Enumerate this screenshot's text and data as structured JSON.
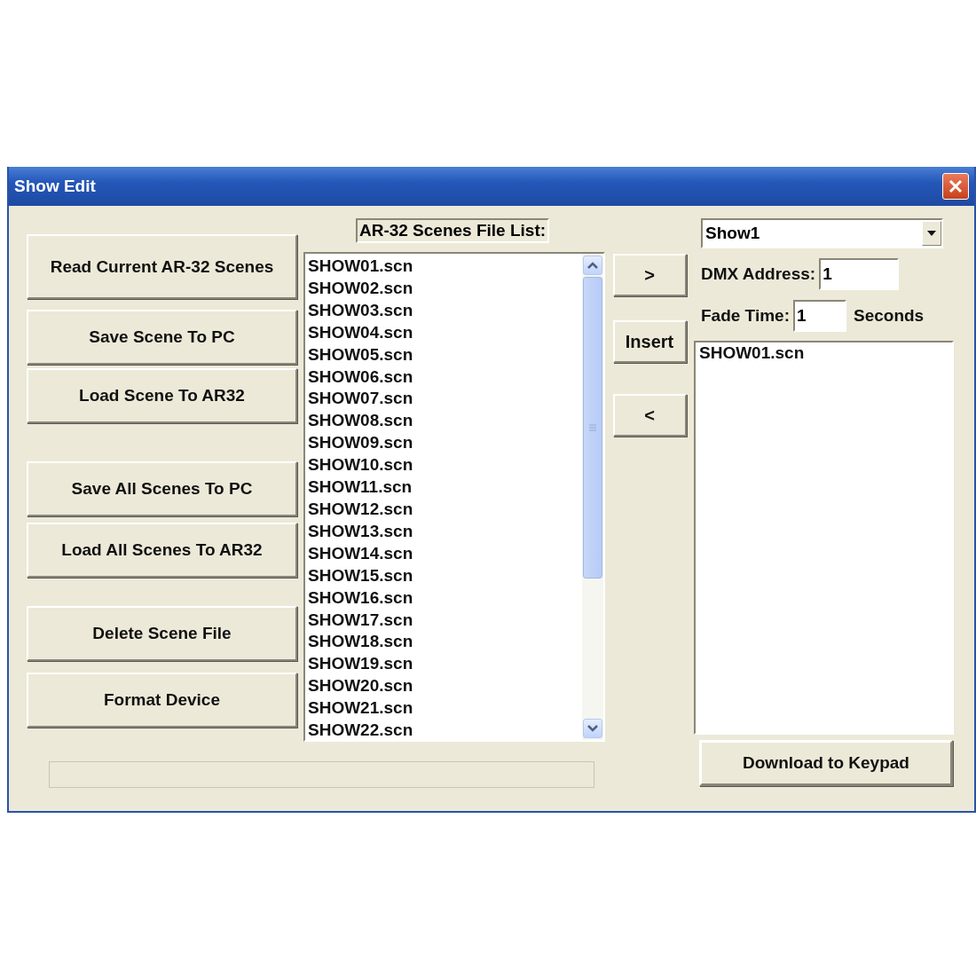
{
  "window": {
    "title": "Show Edit"
  },
  "actions": [
    "Read Current AR-32 Scenes",
    "Save Scene To PC",
    "Load Scene To AR32",
    "Save All Scenes To PC",
    "Load All Scenes To AR32",
    "Delete Scene File",
    "Format Device"
  ],
  "scene_list": {
    "label": "AR-32 Scenes File List:",
    "items": [
      "SHOW01.scn",
      "SHOW02.scn",
      "SHOW03.scn",
      "SHOW04.scn",
      "SHOW05.scn",
      "SHOW06.scn",
      "SHOW07.scn",
      "SHOW08.scn",
      "SHOW09.scn",
      "SHOW10.scn",
      "SHOW11.scn",
      "SHOW12.scn",
      "SHOW13.scn",
      "SHOW14.scn",
      "SHOW15.scn",
      "SHOW16.scn",
      "SHOW17.scn",
      "SHOW18.scn",
      "SHOW19.scn",
      "SHOW20.scn",
      "SHOW21.scn",
      "SHOW22.scn"
    ]
  },
  "progress": {
    "level": 0
  },
  "transfer_buttons": [
    ">",
    "Insert",
    "<"
  ],
  "show_select": {
    "value": "Show1"
  },
  "dmx_address": {
    "label": "DMX Address:",
    "value": "1"
  },
  "fade_time": {
    "label": "Fade Time:",
    "value": "1",
    "unit": "Seconds"
  },
  "show_list": {
    "items": [
      "SHOW01.scn"
    ]
  },
  "download_button": "Download to Keypad"
}
